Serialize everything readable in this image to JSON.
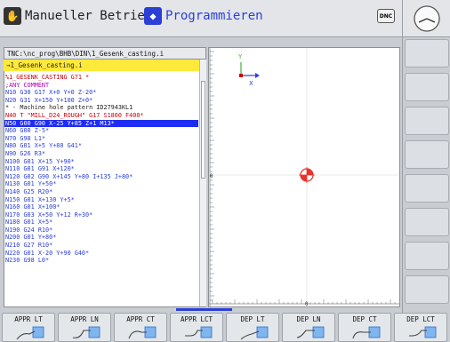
{
  "header": {
    "mode_machine": "Manueller Betrieb",
    "mode_programming": "Programmieren",
    "dnc_label": "DNC",
    "machine_icon": "hand-wheel-icon",
    "programming_icon": "edit-diamond-icon"
  },
  "program": {
    "path": "TNC:\\nc_prog\\BHB\\DIN\\1_Gesenk_casting.i",
    "file": "→1_Gesenk_casting.i",
    "lines": [
      {
        "text": "%1_GESENK_CASTING G71 *",
        "color": "#c8000c"
      },
      {
        "text": ";ANY COMMENT",
        "color": "#b000b0"
      },
      {
        "text": "N10 G30 G17 X+0 Y+0 Z-20*",
        "color": "#2b3fd6"
      },
      {
        "text": "N20 G31 X+150 Y+100 Z+0*",
        "color": "#2b3fd6"
      },
      {
        "text": "* - Machine hole pattern ID27943KL1",
        "color": "#222"
      },
      {
        "text": "N40 T \"MILL_D24_ROUGH\" G17 S1800 F400*",
        "color": "#c8000c"
      },
      {
        "text": "N50 G00 G90 X-25 Y+85 Z+1 M13*",
        "color": "#ffffff",
        "selected": true
      },
      {
        "text": "N60 G00 Z-5*",
        "color": "#2b3fd6"
      },
      {
        "text": "N70 G98 L1*",
        "color": "#2b3fd6"
      },
      {
        "text": "N80 G01 X+5 Y+80 G41*",
        "color": "#2b3fd6"
      },
      {
        "text": "N90 G26 R3*",
        "color": "#2b3fd6"
      },
      {
        "text": "N100 G01 X+15 Y+90*",
        "color": "#2b3fd6"
      },
      {
        "text": "N110 G01 G91 X+120*",
        "color": "#2b3fd6"
      },
      {
        "text": "N120 G02 G90 X+145 Y+80 I+135 J+80*",
        "color": "#2b3fd6"
      },
      {
        "text": "N130 G01 Y+50*",
        "color": "#2b3fd6"
      },
      {
        "text": "N140 G25 R20*",
        "color": "#2b3fd6"
      },
      {
        "text": "N150 G01 X+130 Y+5*",
        "color": "#2b3fd6"
      },
      {
        "text": "N160 G01 X+100*",
        "color": "#2b3fd6"
      },
      {
        "text": "N170 G03 X+50 Y+12 R+30*",
        "color": "#2b3fd6"
      },
      {
        "text": "N180 G01 X+5*",
        "color": "#2b3fd6"
      },
      {
        "text": "N190 G24 R10*",
        "color": "#2b3fd6"
      },
      {
        "text": "N200 G01 Y+80*",
        "color": "#2b3fd6"
      },
      {
        "text": "N210 G27 R10*",
        "color": "#2b3fd6"
      },
      {
        "text": "N220 G01 X-20 Y+90 G40*",
        "color": "#2b3fd6"
      },
      {
        "text": "N230 G98 L0*",
        "color": "#2b3fd6"
      }
    ]
  },
  "graphics": {
    "axis_y": "Y",
    "axis_x": "X",
    "tool_icon": "tool-position-crosshair-icon"
  },
  "softkeys": [
    {
      "label": "APPR LT",
      "icon": "approach-line-tangential-icon"
    },
    {
      "label": "APPR LN",
      "icon": "approach-line-normal-icon"
    },
    {
      "label": "APPR CT",
      "icon": "approach-circle-tangential-icon"
    },
    {
      "label": "APPR LCT",
      "icon": "approach-line-circle-tangential-icon"
    },
    {
      "label": "DEP LT",
      "icon": "depart-line-tangential-icon"
    },
    {
      "label": "DEP LN",
      "icon": "depart-line-normal-icon"
    },
    {
      "label": "DEP CT",
      "icon": "depart-circle-tangential-icon"
    },
    {
      "label": "DEP LCT",
      "icon": "depart-line-circle-tangential-icon"
    }
  ],
  "colors": {
    "selection": "#1f2cf5",
    "accent_blue": "#2b3fd6",
    "file_bar": "#ffe93a",
    "tool_marker": "#e8322c"
  }
}
